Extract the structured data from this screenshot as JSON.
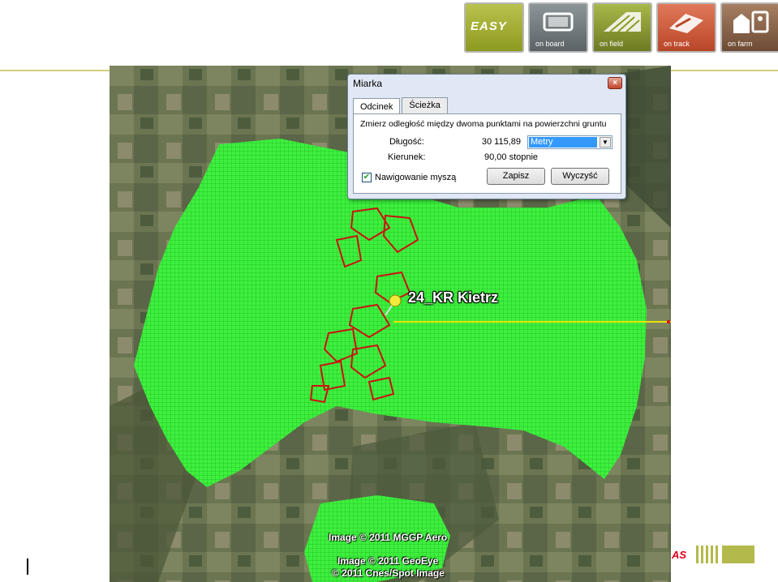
{
  "header": {
    "tiles": [
      {
        "label": "EASY",
        "icon": "easy-logo-icon"
      },
      {
        "label": "on board",
        "icon": "terminal-icon"
      },
      {
        "label": "on field",
        "icon": "field-icon"
      },
      {
        "label": "on track",
        "icon": "track-icon"
      },
      {
        "label": "on farm",
        "icon": "farm-icon"
      }
    ]
  },
  "map": {
    "placemark_label": "24_KR Kietrz",
    "copyrights": [
      "Image © 2011 MGGP Aero",
      "Image © 2011 GeoEye",
      "© 2011 Cnes/Spot Image"
    ],
    "colors": {
      "coverage": "#33ee33",
      "fields": "#cc1111",
      "ruler": "#e8e100"
    }
  },
  "dialog": {
    "title": "Miarka",
    "close_label": "×",
    "tabs": [
      "Odcinek",
      "Ścieżka"
    ],
    "active_tab": "Odcinek",
    "description": "Zmierz odległość między dwoma punktami na powierzchni gruntu",
    "length_label": "Długość:",
    "length_value": "30 115,89",
    "unit_selected": "Metry",
    "direction_label": "Kierunek:",
    "direction_value": "90,00 stopnie",
    "mouse_nav_label": "Nawigowanie myszą",
    "mouse_nav_checked": true,
    "save_button": "Zapisz",
    "clear_button": "Wyczyść"
  },
  "footer": {
    "brand": "AS"
  }
}
